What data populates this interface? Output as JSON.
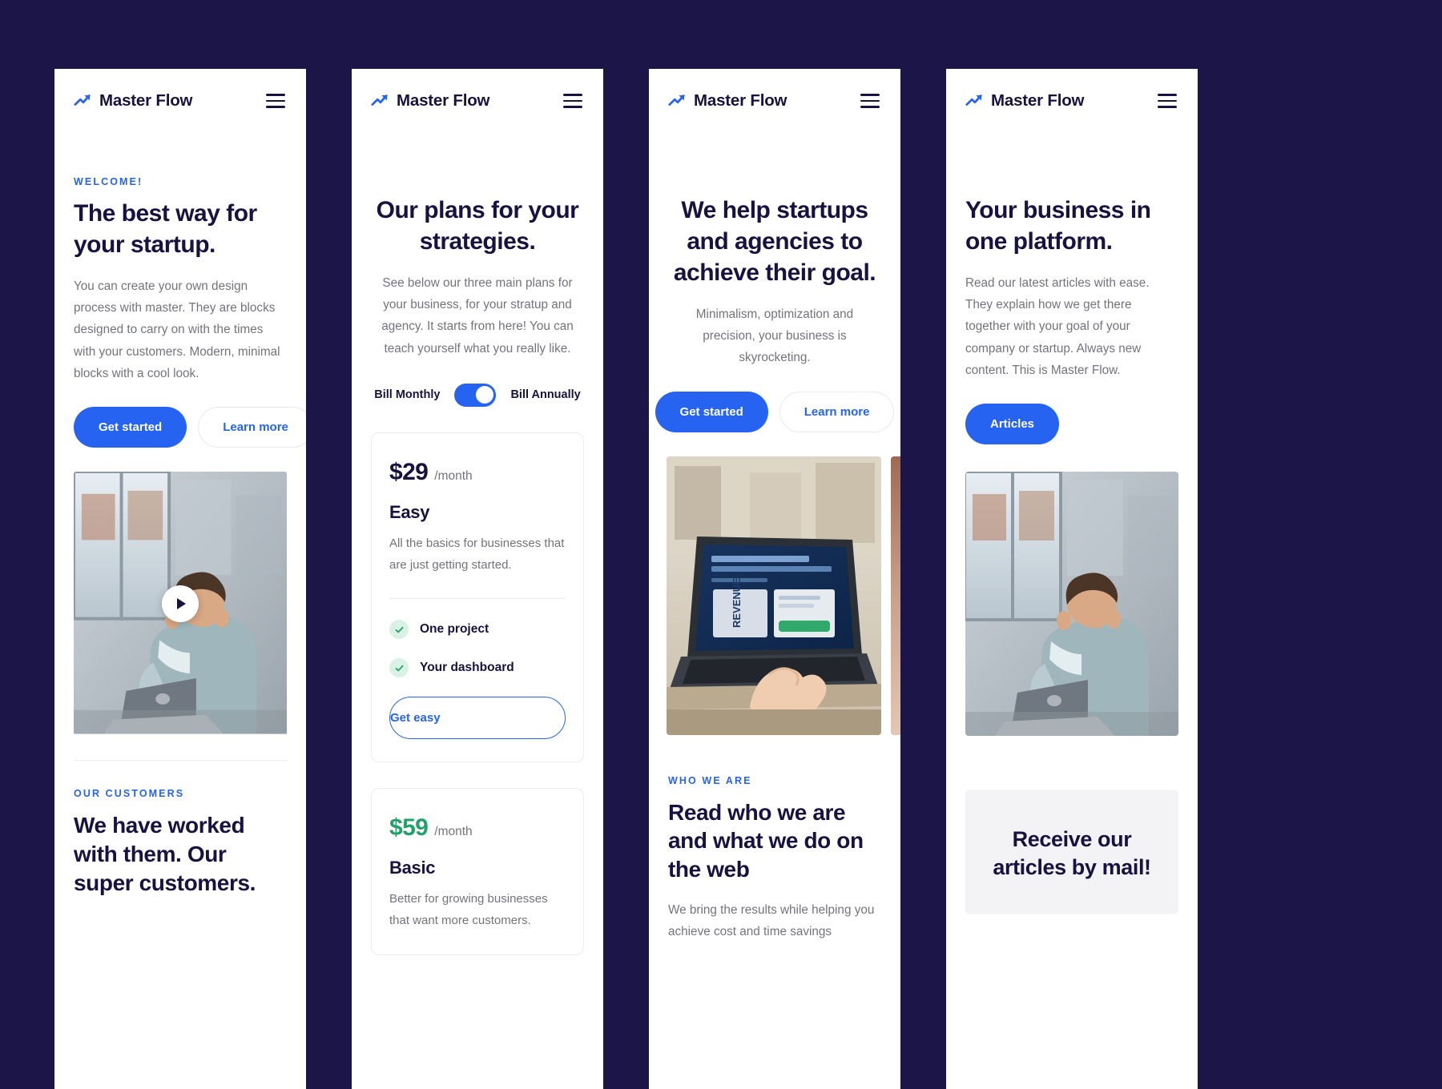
{
  "theme": {
    "page_bg": "#1c1547",
    "accent_blue": "#2563f0",
    "ink": "#171240",
    "muted": "#73737d",
    "green": "#22a16b",
    "green_soft": "#d9f2e5",
    "card_border": "#ececf1",
    "panel_bg": "#ffffff"
  },
  "brand": {
    "name": "Master Flow",
    "logo_icon": "trending-up-arrow-icon",
    "menu_icon": "hamburger-menu-icon"
  },
  "screens": [
    {
      "id": "home",
      "eyebrow": "WELCOME!",
      "heading": "The best way for your startup.",
      "body": "You can create your own design process with master. They are blocks designed to carry on with the times with your customers. Modern, minimal blocks with a cool look.",
      "primary_button": "Get started",
      "secondary_button": "Learn more",
      "video_play_icon": "play-icon",
      "section_eyebrow": "OUR CUSTOMERS",
      "section_heading": "We have worked with them. Our super customers."
    },
    {
      "id": "pricing",
      "heading": "Our plans for your strategies.",
      "body": "See below our three main plans for your business, for your stratup and agency. It starts from here! You can teach yourself what you really like.",
      "billing": {
        "left_label": "Bill Monthly",
        "right_label": "Bill Annually",
        "state": "on"
      },
      "plans": [
        {
          "price": "$29",
          "period": "/month",
          "name": "Easy",
          "description": "All the basics for businesses that are just getting started.",
          "features": [
            "One project",
            "Your dashboard"
          ],
          "cta": "Get easy"
        },
        {
          "price": "$59",
          "period": "/month",
          "name": "Basic",
          "description": "Better for growing businesses that want more customers."
        }
      ]
    },
    {
      "id": "about",
      "heading": "We help startups and agencies to achieve their goal.",
      "body": "Minimalism, optimization and precision, your business is skyrocketing.",
      "primary_button": "Get started",
      "secondary_button": "Learn more",
      "section_eyebrow": "WHO WE ARE",
      "section_heading": "Read who we are and what we do on the web",
      "section_body": "We bring the results while helping you achieve cost and time savings"
    },
    {
      "id": "blog",
      "heading": "Your business in one platform.",
      "body": "Read our latest articles with ease. They explain how we get there together with your goal of your company or startup. Always new content. This is Master Flow.",
      "primary_button": "Articles",
      "mail_title": "Receive our articles by mail!"
    }
  ]
}
